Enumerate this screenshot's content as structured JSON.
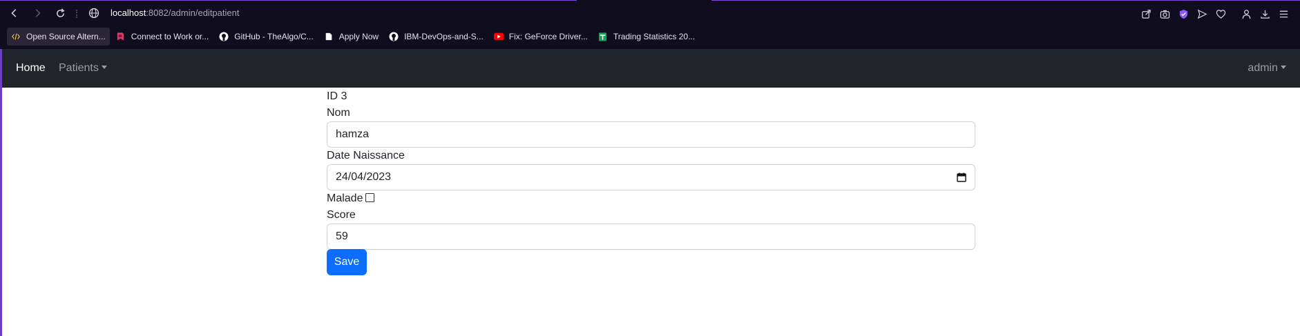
{
  "browser": {
    "url_host": "localhost",
    "url_rest": ":8082/admin/editpatient",
    "bookmarks": [
      {
        "label": "Open Source Altern...",
        "icon": "code-icon"
      },
      {
        "label": "Connect to Work or...",
        "icon": "bookmark-red-icon"
      },
      {
        "label": "GitHub - TheAlgo/C...",
        "icon": "github-icon"
      },
      {
        "label": "Apply Now",
        "icon": "document-icon"
      },
      {
        "label": "IBM-DevOps-and-S...",
        "icon": "github-icon"
      },
      {
        "label": "Fix: GeForce Driver...",
        "icon": "youtube-icon"
      },
      {
        "label": "Trading Statistics 20...",
        "icon": "sheets-icon"
      }
    ]
  },
  "navbar": {
    "home": "Home",
    "patients": "Patients",
    "user": "admin"
  },
  "form": {
    "id_text": "ID 3",
    "nom_label": "Nom",
    "nom_value": "hamza",
    "date_label": "Date Naissance",
    "date_value": "24/04/2023",
    "malade_label": "Malade",
    "malade_checked": false,
    "score_label": "Score",
    "score_value": "59",
    "save_label": "Save"
  },
  "colors": {
    "primary": "#0d6efd",
    "navbar_bg": "#212529",
    "browser_bg": "#100d1f"
  }
}
